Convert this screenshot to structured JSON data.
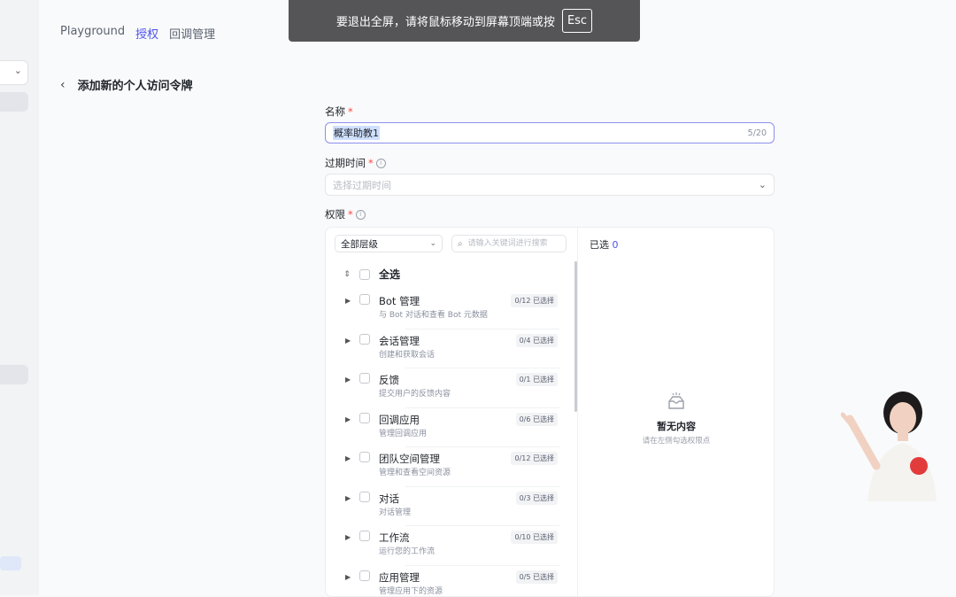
{
  "toast": {
    "message": "要退出全屏，请将鼠标移动到屏幕顶端或按",
    "key": "Esc"
  },
  "topnav": {
    "tabs": [
      "Playground",
      "授权",
      "回调管理"
    ],
    "active_index": 1
  },
  "header": {
    "back_icon": "chevron-left-icon",
    "title": "添加新的个人访问令牌"
  },
  "form": {
    "name": {
      "label": "名称",
      "required_mark": "*",
      "value": "概率助教1",
      "counter": "5/20"
    },
    "expiry": {
      "label": "过期时间",
      "required_mark": "*",
      "info_icon": "ⓘ",
      "placeholder": "选择过期时间"
    },
    "permissions": {
      "label": "权限",
      "required_mark": "*",
      "info_icon": "ⓘ"
    }
  },
  "permissions_panel": {
    "level_select": "全部层级",
    "search_placeholder": "请输入关键词进行搜索",
    "select_all": "全选",
    "items": [
      {
        "name": "Bot 管理",
        "desc": "与 Bot 对话和查看 Bot 元数据",
        "badge": "0/12 已选择"
      },
      {
        "name": "会话管理",
        "desc": "创建和获取会话",
        "badge": "0/4 已选择"
      },
      {
        "name": "反馈",
        "desc": "提交用户的反馈内容",
        "badge": "0/1 已选择"
      },
      {
        "name": "回调应用",
        "desc": "管理回调应用",
        "badge": "0/6 已选择"
      },
      {
        "name": "团队空间管理",
        "desc": "管理和查看空间资源",
        "badge": "0/12 已选择"
      },
      {
        "name": "对话",
        "desc": "对话管理",
        "badge": "0/3 已选择"
      },
      {
        "name": "工作流",
        "desc": "运行您的工作流",
        "badge": "0/10 已选择"
      },
      {
        "name": "应用管理",
        "desc": "管理应用下的资源",
        "badge": "0/5 已选择"
      }
    ],
    "selected": {
      "label": "已选",
      "count": "0"
    },
    "empty": {
      "title": "暂无内容",
      "subtitle": "请在左侧勾选权限点"
    }
  },
  "colors": {
    "accent": "#4d53e8",
    "required": "#f54a45"
  }
}
